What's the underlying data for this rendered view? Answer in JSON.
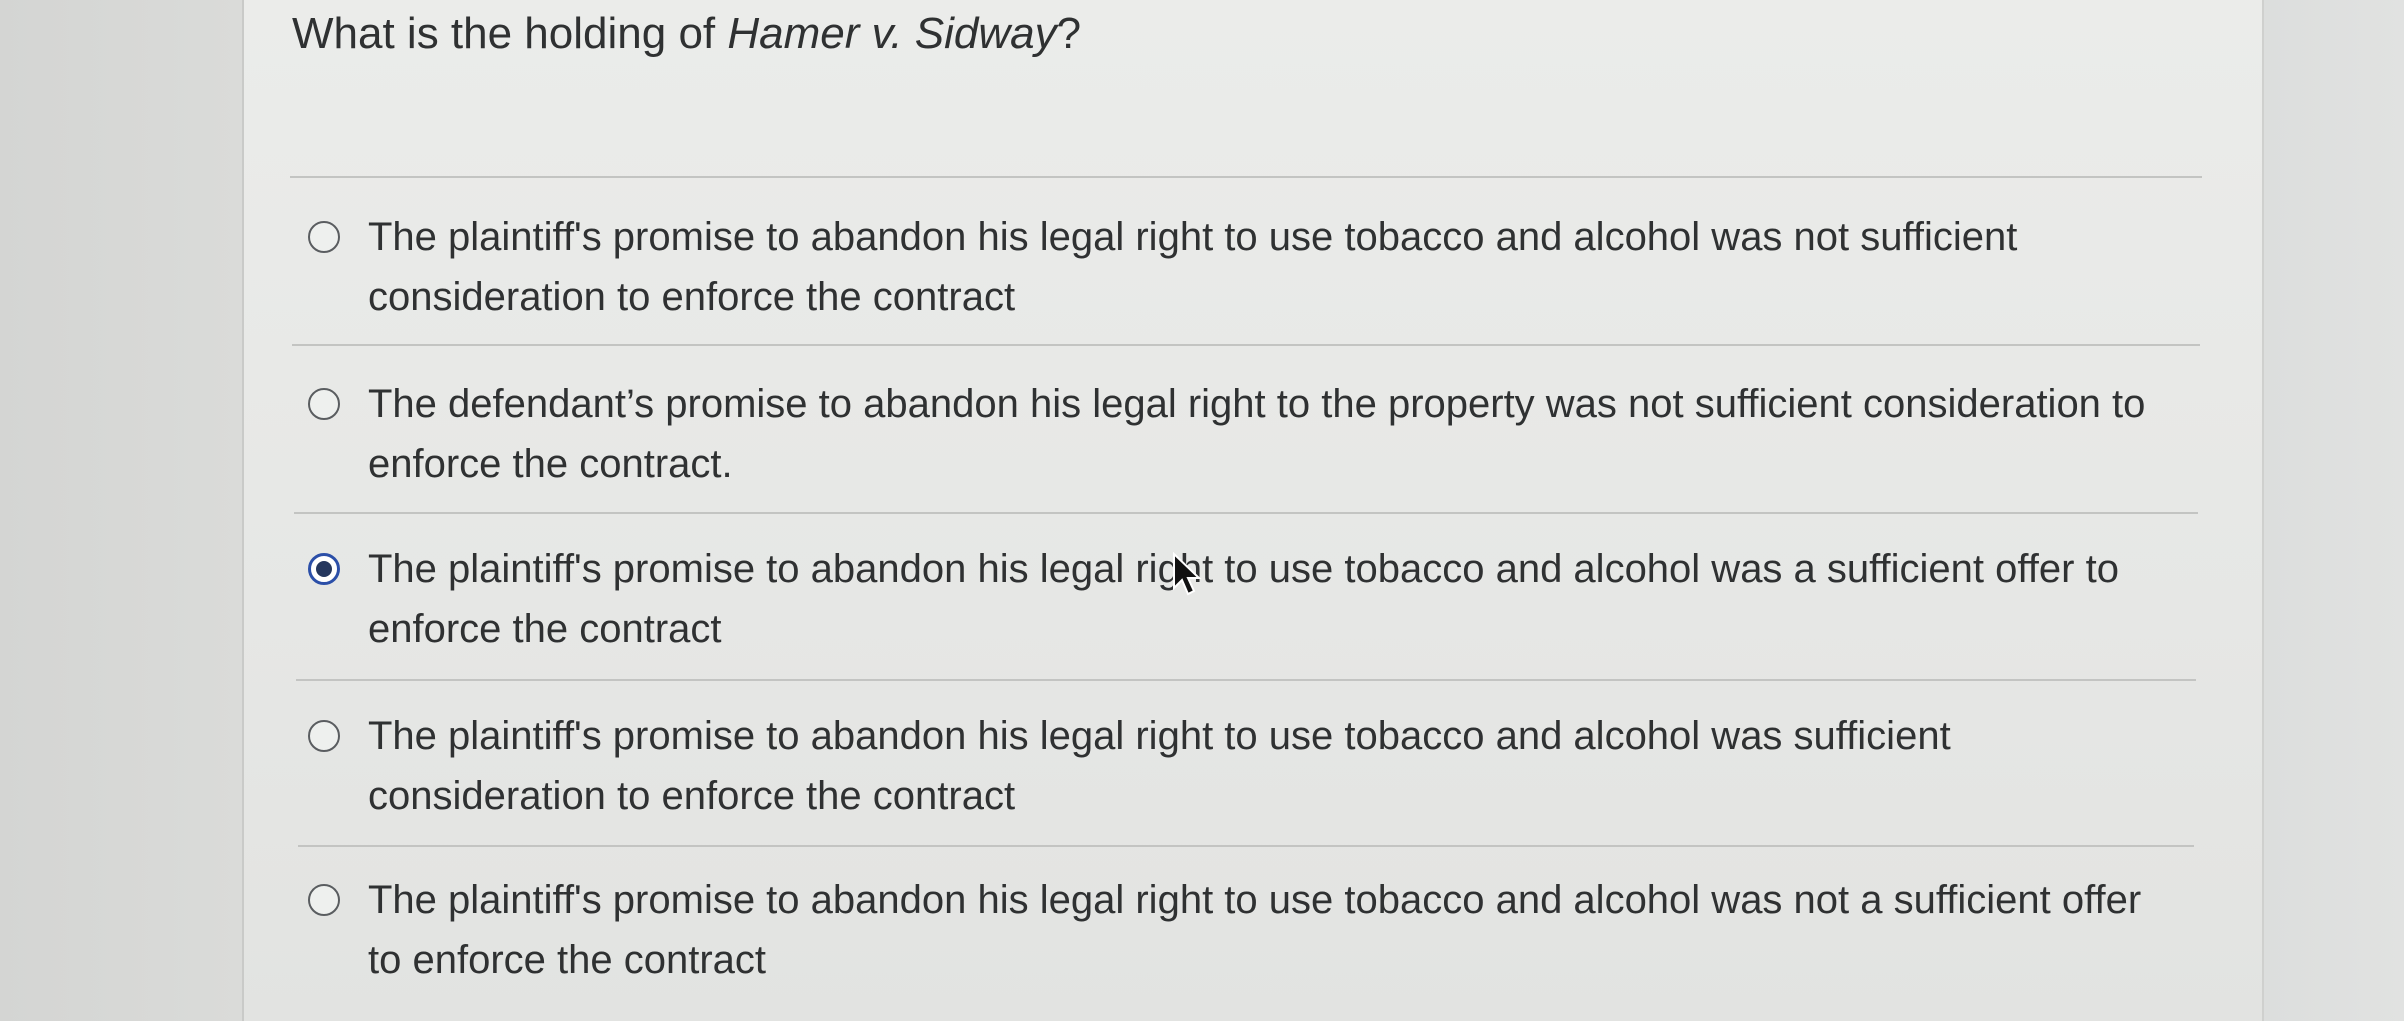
{
  "question": {
    "prefix": "What is the holding of ",
    "case_name": "Hamer v. Sidway",
    "suffix": "?"
  },
  "options": [
    {
      "text": "The plaintiff's promise to abandon his legal right to use tobacco and alcohol was not sufficient consideration to enforce the contract",
      "selected": false
    },
    {
      "text": "The defendant’s promise to abandon his legal right to the property was not sufficient consideration to enforce the contract.",
      "selected": false
    },
    {
      "text": "The plaintiff's promise to abandon his legal right to use tobacco and alcohol was a sufficient offer to enforce the contract",
      "selected": true
    },
    {
      "text": "The plaintiff's promise to abandon his legal right to use tobacco and alcohol was sufficient consideration to enforce the contract",
      "selected": false
    },
    {
      "text": "The plaintiff's promise to abandon his legal right to use tobacco and alcohol was not a sufficient offer to enforce the contract",
      "selected": false
    }
  ],
  "colors": {
    "text": "#2f3132",
    "radio_selected": "#2b4fa8"
  }
}
